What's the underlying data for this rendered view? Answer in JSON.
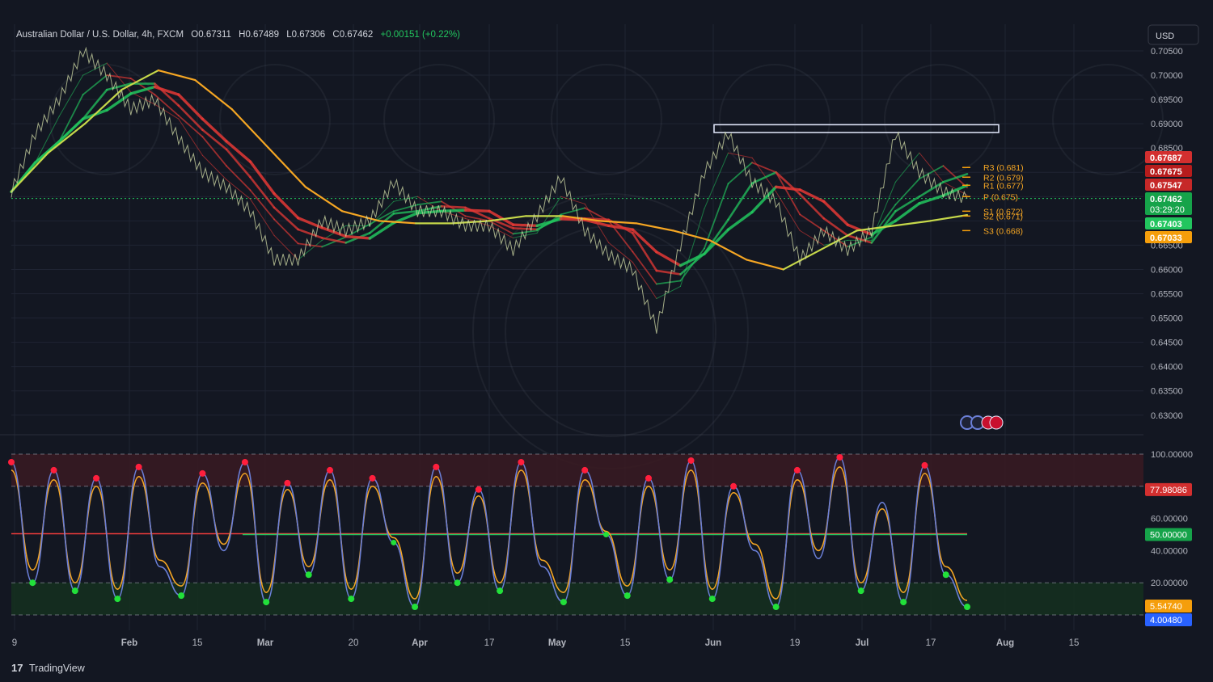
{
  "header": {
    "symbol": "Australian Dollar / U.S. Dollar, 4h, FXCM",
    "open": "O0.67311",
    "high": "H0.67489",
    "low": "L0.67306",
    "close": "C0.67462",
    "change": "+0.00151 (+0.22%)"
  },
  "currency_button": "USD",
  "brand": {
    "logo_mark": "17",
    "name": "TradingView"
  },
  "colors": {
    "background": "#131722",
    "up": "#22c55e",
    "down": "#ef3b3b",
    "pivot_line": "#f59e0b",
    "stoch_k": "#6b7fd7",
    "stoch_d": "#f5a623",
    "overbought_zone": "#3a1a22",
    "oversold_zone": "#15301f"
  },
  "chart_data": [
    {
      "type": "line",
      "title": "Australian Dollar / U.S. Dollar, 4h, FXCM",
      "x_ticks": [
        "9",
        "Feb",
        "15",
        "Mar",
        "20",
        "Apr",
        "17",
        "May",
        "15",
        "Jun",
        "19",
        "Jul",
        "17",
        "Aug",
        "15"
      ],
      "y_ticks": [
        "0.70500",
        "0.70000",
        "0.69500",
        "0.69000",
        "0.68500",
        "0.68000",
        "0.67500",
        "0.67000",
        "0.66500",
        "0.66000",
        "0.65500",
        "0.65000",
        "0.64500",
        "0.64000",
        "0.63500",
        "0.63000"
      ],
      "ylim": [
        0.6285,
        0.7095
      ],
      "grid": true,
      "series": [
        {
          "name": "price",
          "values": [
            0.676,
            0.688,
            0.695,
            0.705,
            0.7,
            0.693,
            0.695,
            0.687,
            0.68,
            0.677,
            0.672,
            0.662,
            0.662,
            0.67,
            0.668,
            0.67,
            0.678,
            0.672,
            0.672,
            0.669,
            0.669,
            0.664,
            0.671,
            0.679,
            0.668,
            0.663,
            0.66,
            0.648,
            0.665,
            0.68,
            0.688,
            0.678,
            0.674,
            0.662,
            0.668,
            0.664,
            0.668,
            0.688,
            0.68,
            0.676,
            0.6746
          ]
        },
        {
          "name": "long-ma",
          "values": [
            0.676,
            0.684,
            0.69,
            0.697,
            0.701,
            0.699,
            0.693,
            0.685,
            0.677,
            0.672,
            0.67,
            0.6695,
            0.6695,
            0.67,
            0.671,
            0.671,
            0.67,
            0.6695,
            0.668,
            0.666,
            0.662,
            0.66,
            0.664,
            0.668,
            0.669,
            0.67,
            0.6712
          ]
        }
      ],
      "pivots": [
        {
          "label": "R3 (0.681)",
          "value": 0.681
        },
        {
          "label": "R2 (0.679)",
          "value": 0.679
        },
        {
          "label": "R1 (0.677)",
          "value": 0.677
        },
        {
          "label": "P (0.675)",
          "value": 0.675
        },
        {
          "label": "S1 (0.672)",
          "value": 0.672
        },
        {
          "label": "S2 (0.671)",
          "value": 0.671
        },
        {
          "label": "S3 (0.668)",
          "value": 0.668
        }
      ],
      "resistance_zone": [
        0.6882,
        0.6898
      ],
      "price_tags": [
        {
          "text": "0.67687",
          "value": 0.67687,
          "color": "#d32f2f"
        },
        {
          "text": "0.67675",
          "value": 0.67675,
          "color": "#b71c1c"
        },
        {
          "text": "0.67547",
          "value": 0.67547,
          "color": "#c62828"
        },
        {
          "text": "0.67462",
          "value": 0.67462,
          "color": "#16a34a",
          "sub": "03:29:20"
        },
        {
          "text": "0.67403",
          "value": 0.67403,
          "color": "#22c55e"
        },
        {
          "text": "0.67033",
          "value": 0.67033,
          "color": "#f59e0b"
        }
      ]
    },
    {
      "type": "line",
      "y_ticks": [
        "100.00000",
        "60.00000",
        "40.00000",
        "20.00000"
      ],
      "ylim": [
        0,
        100
      ],
      "levels": [
        80,
        50,
        20
      ],
      "series": [
        {
          "name": "%K",
          "values": [
            95,
            20,
            90,
            15,
            85,
            10,
            92,
            30,
            12,
            88,
            40,
            95,
            8,
            82,
            25,
            90,
            10,
            85,
            45,
            5,
            92,
            20,
            78,
            15,
            95,
            30,
            8,
            90,
            50,
            12,
            85,
            22,
            96,
            10,
            80,
            40,
            5,
            90,
            35,
            98,
            15,
            70,
            8,
            93,
            25,
            5
          ]
        },
        {
          "name": "%D",
          "values": [
            90,
            28,
            84,
            20,
            80,
            16,
            86,
            34,
            18,
            82,
            44,
            88,
            14,
            78,
            30,
            84,
            16,
            80,
            48,
            10,
            86,
            26,
            74,
            20,
            90,
            34,
            14,
            84,
            52,
            18,
            80,
            28,
            90,
            16,
            76,
            44,
            10,
            84,
            40,
            92,
            20,
            66,
            14,
            88,
            30,
            9
          ]
        }
      ],
      "value_tags": [
        {
          "text": "77.98086",
          "value": 77.98086,
          "color": "#d32f2f"
        },
        {
          "text": "50.00000",
          "value": 50,
          "color": "#16a34a"
        },
        {
          "text": "5.54740",
          "value": 5.5474,
          "color": "#f59e0b"
        },
        {
          "text": "4.00480",
          "value": 4.0048,
          "color": "#2962ff"
        }
      ]
    }
  ]
}
